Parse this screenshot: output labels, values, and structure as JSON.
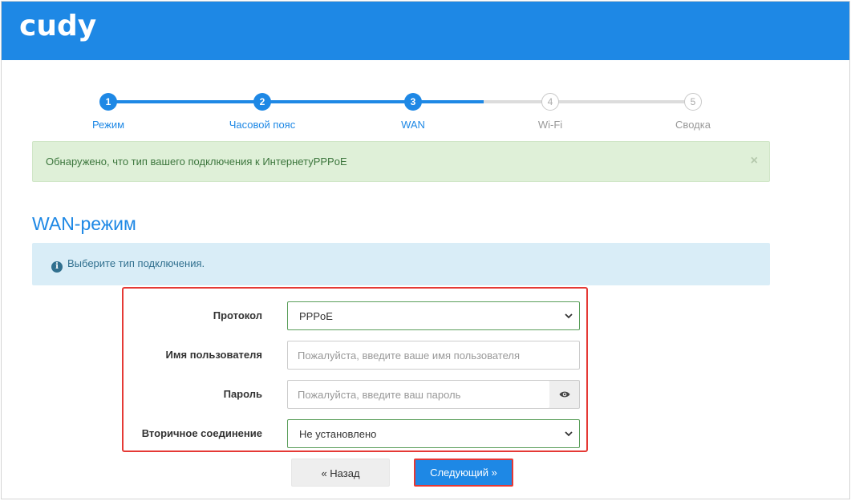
{
  "header": {
    "logo_text": "cudy",
    "background_color": "#1e88e5"
  },
  "stepper": {
    "steps": [
      {
        "number": "1",
        "label": "Режим",
        "state": "done"
      },
      {
        "number": "2",
        "label": "Часовой пояс",
        "state": "done"
      },
      {
        "number": "3",
        "label": "WAN",
        "state": "current"
      },
      {
        "number": "4",
        "label": "Wi-Fi",
        "state": "todo"
      },
      {
        "number": "5",
        "label": "Сводка",
        "state": "todo"
      }
    ]
  },
  "alert_success": {
    "text": "Обнаружено, что тип вашего подключения к ИнтернетуPPPoE",
    "close_glyph": "×"
  },
  "section": {
    "title": "WAN-режим"
  },
  "alert_info": {
    "icon": "info-icon",
    "text": "Выберите тип подключения."
  },
  "form": {
    "protocol": {
      "label": "Протокол",
      "value": "PPPoE"
    },
    "username": {
      "label": "Имя пользователя",
      "value": "",
      "placeholder": "Пожалуйста, введите ваше имя пользователя"
    },
    "password": {
      "label": "Пароль",
      "value": "",
      "placeholder": "Пожалуйста, введите ваш пароль",
      "toggle_icon": "eye-icon"
    },
    "secondary": {
      "label": "Вторичное соединение",
      "value": "Не установлено"
    }
  },
  "buttons": {
    "back_label": "« Назад",
    "next_label": "Следующий »"
  },
  "colors": {
    "accent": "#1e88e5",
    "highlight_border": "#e53935",
    "success_bg": "#dff0d8",
    "info_bg": "#d9edf7"
  }
}
